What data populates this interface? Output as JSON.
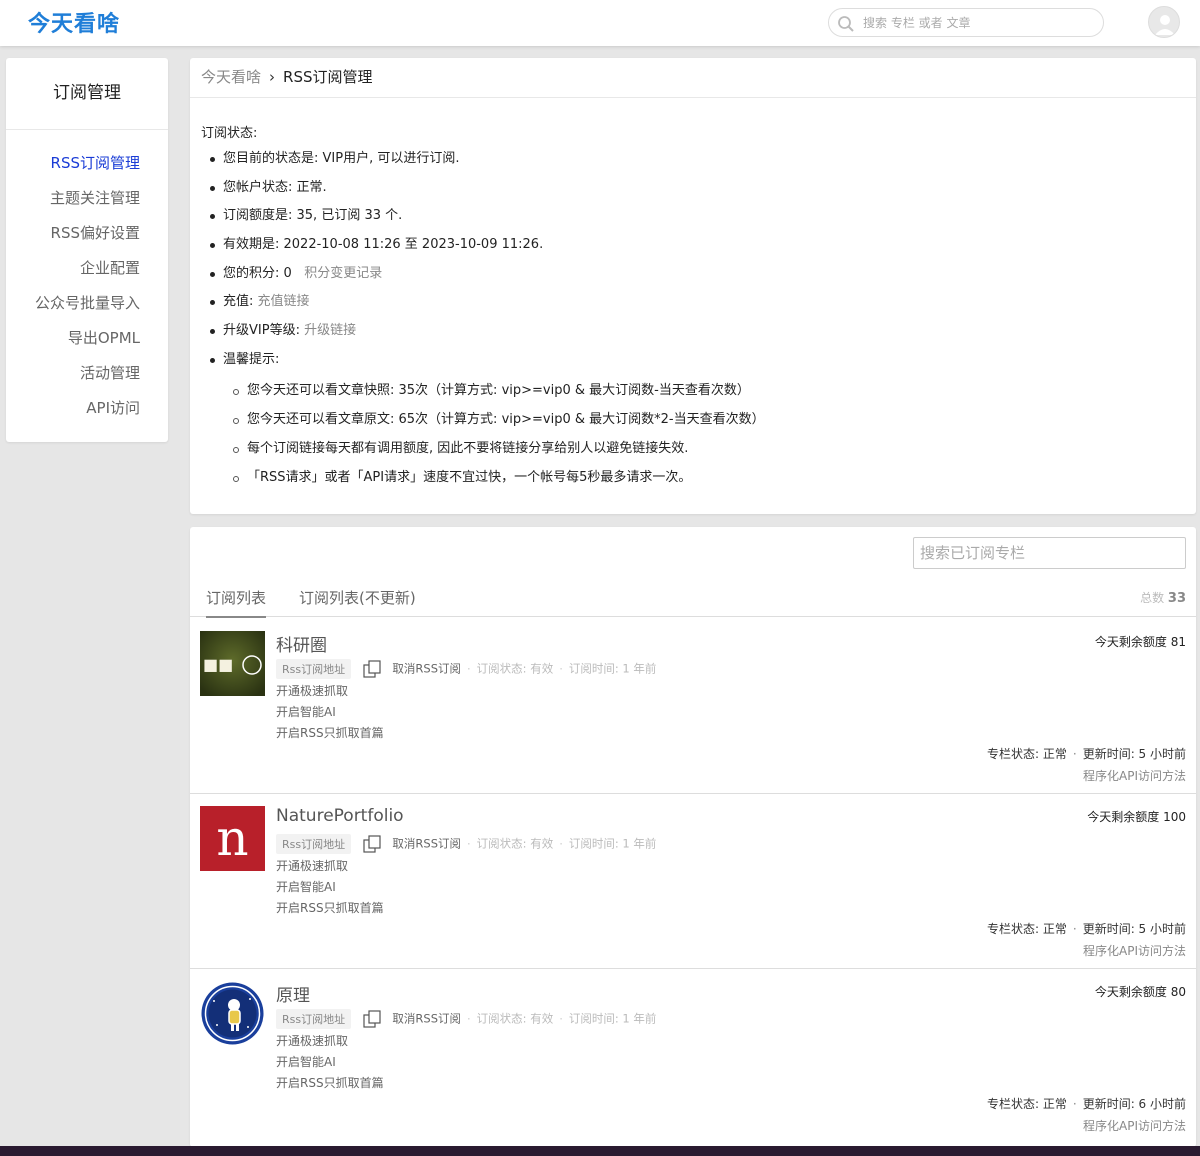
{
  "header": {
    "logo": "今天看啥",
    "search_placeholder": "搜索 专栏 或者 文章"
  },
  "sidebar": {
    "title": "订阅管理",
    "items": [
      {
        "label": "RSS订阅管理",
        "active": true
      },
      {
        "label": "主题关注管理"
      },
      {
        "label": "RSS偏好设置"
      },
      {
        "label": "企业配置"
      },
      {
        "label": "公众号批量导入"
      },
      {
        "label": "导出OPML"
      },
      {
        "label": "活动管理"
      },
      {
        "label": "API访问"
      }
    ]
  },
  "breadcrumb": {
    "home": "今天看啥",
    "separator": "›",
    "current": "RSS订阅管理"
  },
  "status": {
    "heading": "订阅状态:",
    "items": [
      "您目前的状态是: VIP用户, 可以进行订阅.",
      "您帐户状态: 正常.",
      "订阅额度是: 35, 已订阅 33 个.",
      "有效期是: 2022-10-08 11:26 至 2023-10-09 11:26."
    ],
    "points_label": "您的积分:  0",
    "points_link": "积分变更记录",
    "recharge_label": "充值: ",
    "recharge_link": "充值链接",
    "upgrade_label": "升级VIP等级: ",
    "upgrade_link": "升级链接",
    "tips_label": "温馨提示:",
    "tips": [
      "您今天还可以看文章快照: 35次（计算方式: vip>=vip0 & 最大订阅数-当天查看次数）",
      "您今天还可以看文章原文: 65次（计算方式: vip>=vip0 & 最大订阅数*2-当天查看次数）",
      "每个订阅链接每天都有调用额度, 因此不要将链接分享给别人以避免链接失效.",
      "「RSS请求」或者「API请求」速度不宜过快，一个帐号每5秒最多请求一次。"
    ]
  },
  "subscriptions": {
    "search_placeholder": "搜索已订阅专栏",
    "tabs": [
      "订阅列表",
      "订阅列表(不更新)"
    ],
    "total_label": "总数",
    "total_value": "33",
    "labels": {
      "rss_address": "Rss订阅地址",
      "unsubscribe": "取消RSS订阅",
      "sub_status": "订阅状态: 有效",
      "sub_time": "订阅时间: 1 年前",
      "fast_fetch": "开通极速抓取",
      "smart_ai": "开启智能AI",
      "first_only": "开启RSS只抓取首篇",
      "column_status": "专栏状态: 正常",
      "api_access": "程序化API访问方法"
    },
    "rows": [
      {
        "name": "科研圈",
        "quota": "今天剩余额度 81",
        "updated": "更新时间: 5 小时前",
        "logo": "keyanquan-logo"
      },
      {
        "name": "NaturePortfolio",
        "quota": "今天剩余额度 100",
        "updated": "更新时间: 5 小时前",
        "logo": "nature-logo"
      },
      {
        "name": "原理",
        "quota": "今天剩余额度 80",
        "updated": "更新时间: 6 小时前",
        "logo": "yuanli-logo"
      }
    ]
  }
}
